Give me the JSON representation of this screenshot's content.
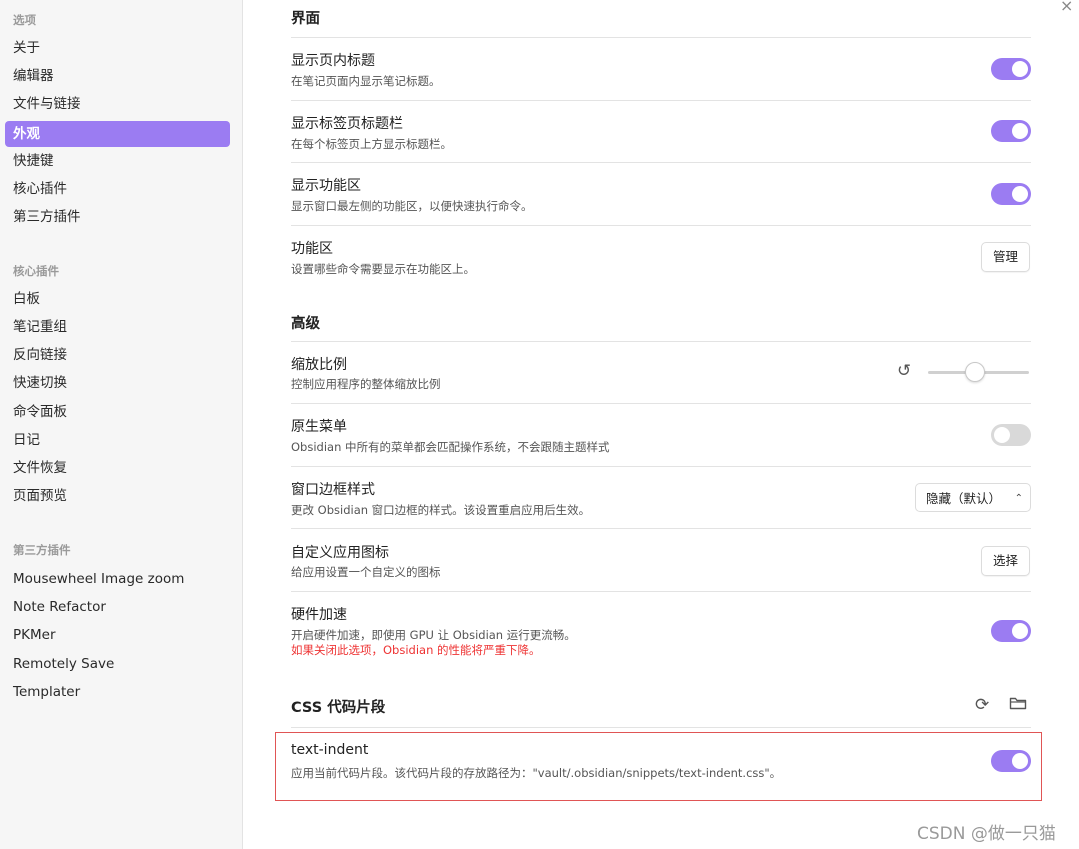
{
  "sidebar": {
    "section_options": "选项",
    "options": [
      "关于",
      "编辑器",
      "文件与链接",
      "外观",
      "快捷键",
      "核心插件",
      "第三方插件"
    ],
    "section_core": "核心插件",
    "core": [
      "白板",
      "笔记重组",
      "反向链接",
      "快速切换",
      "命令面板",
      "日记",
      "文件恢复",
      "页面预览"
    ],
    "section_third": "第三方插件",
    "third": [
      "Mousewheel Image zoom",
      "Note Refactor",
      "PKMer",
      "Remotely Save",
      "Templater"
    ]
  },
  "main": {
    "heading_interface": "界面",
    "inline_title": {
      "title": "显示页内标题",
      "desc": "在笔记页面内显示笔记标题。",
      "enabled": true
    },
    "tab_title_bar": {
      "title": "显示标签页标题栏",
      "desc": "在每个标签页上方显示标题栏。",
      "enabled": true
    },
    "ribbon": {
      "title": "显示功能区",
      "desc": "显示窗口最左侧的功能区，以便快速执行命令。",
      "enabled": true
    },
    "ribbon_config": {
      "title": "功能区",
      "desc": "设置哪些命令需要显示在功能区上。",
      "button": "管理"
    },
    "heading_advanced": "高级",
    "zoom": {
      "title": "缩放比例",
      "desc": "控制应用程序的整体缩放比例"
    },
    "native_menu": {
      "title": "原生菜单",
      "desc": "Obsidian 中所有的菜单都会匹配操作系统，不会跟随主题样式",
      "enabled": false
    },
    "frame_style": {
      "title": "窗口边框样式",
      "desc": "更改 Obsidian 窗口边框的样式。该设置重启应用后生效。",
      "value": "隐藏（默认）"
    },
    "app_icon": {
      "title": "自定义应用图标",
      "desc": "给应用设置一个自定义的图标",
      "button": "选择"
    },
    "hw_accel": {
      "title": "硬件加速",
      "desc": "开启硬件加速，即使用 GPU 让 Obsidian 运行更流畅。",
      "warning": "如果关闭此选项，Obsidian 的性能将严重下降。",
      "enabled": true
    },
    "heading_css": "CSS 代码片段",
    "snippet": {
      "title": "text-indent",
      "desc": "应用当前代码片段。该代码片段的存放路径为：\"vault/.obsidian/snippets/text-indent.css\"。",
      "enabled": true
    }
  },
  "icons": {
    "close": "×",
    "reset": "↺",
    "reload": "⟳",
    "folder": "folder-icon",
    "caret": "⌃⌄"
  },
  "watermark": "CSDN @做一只猫",
  "colors": {
    "accent": "#9b7cf2",
    "warning": "#e33333",
    "highlight": "#e05555"
  }
}
